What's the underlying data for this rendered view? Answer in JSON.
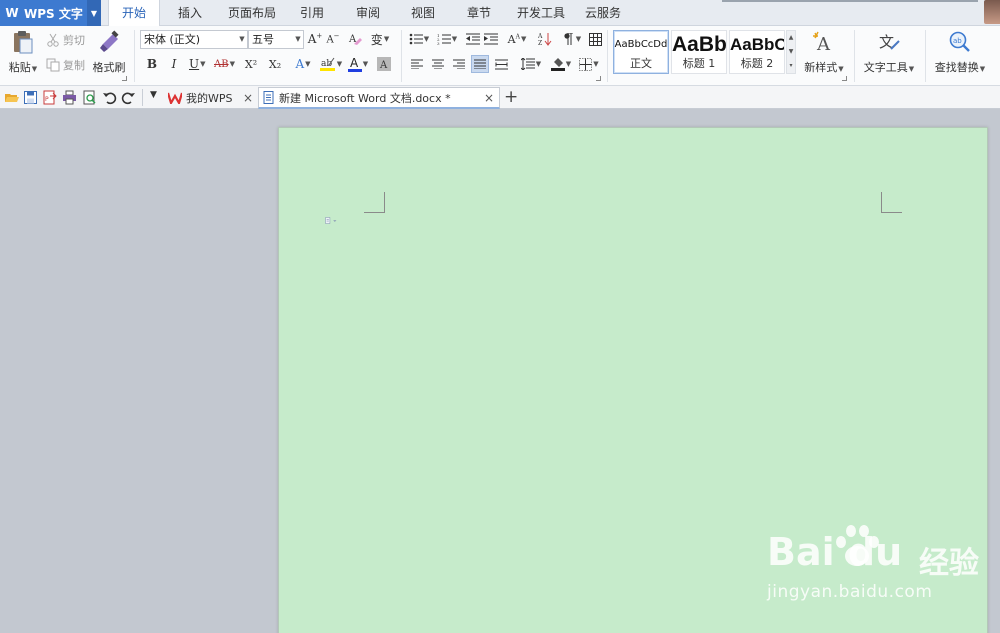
{
  "app": {
    "title": "WPS 文字",
    "accent_color": "#3d7ad0"
  },
  "ribbon_tabs": [
    {
      "label": "开始",
      "active": true
    },
    {
      "label": "插入"
    },
    {
      "label": "页面布局"
    },
    {
      "label": "引用"
    },
    {
      "label": "审阅"
    },
    {
      "label": "视图"
    },
    {
      "label": "章节"
    },
    {
      "label": "开发工具"
    },
    {
      "label": "云服务"
    }
  ],
  "clipboard": {
    "paste_label": "粘贴",
    "cut_label": "剪切",
    "copy_label": "复制",
    "format_painter_label": "格式刷"
  },
  "font": {
    "name_value": "宋体 (正文)",
    "size_value": "五号",
    "bold": "B",
    "italic": "I",
    "underline": "U",
    "strikethrough": "AB",
    "superscript": "X²",
    "subscript": "X₂"
  },
  "styles": [
    {
      "sample": "AaBbCcDd",
      "name": "正文",
      "selected": true
    },
    {
      "sample": "AaBb",
      "name": "标题 1"
    },
    {
      "sample": "AaBbC",
      "name": "标题 2"
    }
  ],
  "tools": {
    "new_style_label": "新样式",
    "text_tools_label": "文字工具",
    "find_replace_label": "查找替换"
  },
  "doc_tabs": [
    {
      "label": "我的WPS"
    },
    {
      "label": "新建 Microsoft Word 文档.docx *",
      "active": true
    }
  ],
  "new_tab_glyph": "+",
  "page": {
    "background_color": "#c6ebcb"
  },
  "watermark": {
    "brand": "Bai  du",
    "cn": "经验",
    "url": "jingyan.baidu.com"
  }
}
